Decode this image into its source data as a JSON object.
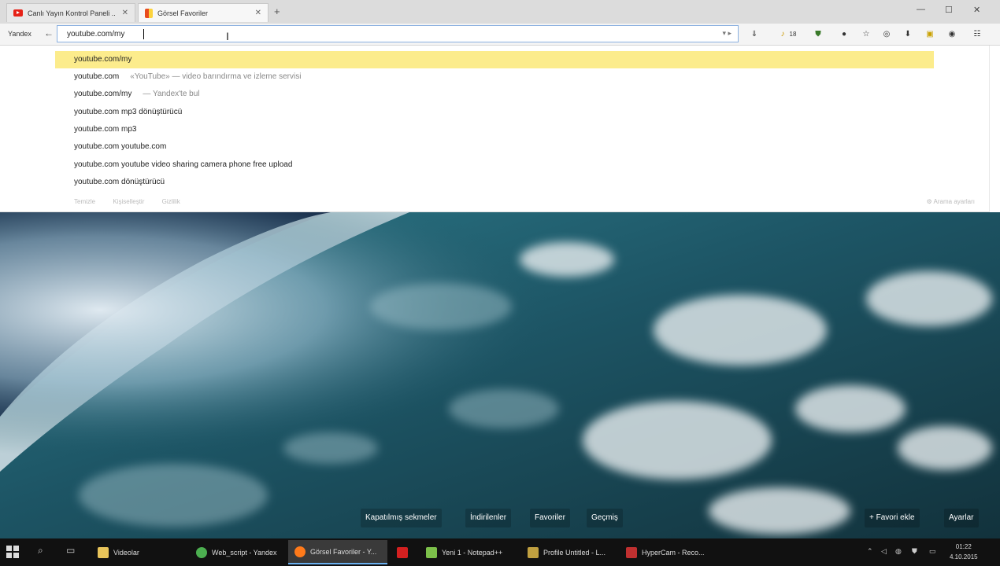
{
  "tabs": [
    {
      "label": "Canlı Yayın Kontrol Paneli ..",
      "icon": "youtube-icon",
      "active": false
    },
    {
      "label": "Görsel Favoriler",
      "icon": "yandex-icon",
      "active": true
    }
  ],
  "toolbar": {
    "menu_label": "Yandex",
    "url_value": "youtube.com/my",
    "extension_badge": "18"
  },
  "suggestions": [
    {
      "text": "youtube.com/my",
      "desc": "",
      "selected": true
    },
    {
      "text": "youtube.com",
      "desc": "«YouTube» — video barındırma ve izleme servisi",
      "selected": false
    },
    {
      "text": "youtube.com/my",
      "desc": "— Yandex'te bul",
      "selected": false
    },
    {
      "text": "youtube.com mp3 dönüştürücü",
      "desc": "",
      "selected": false
    },
    {
      "text": "youtube.com mp3",
      "desc": "",
      "selected": false
    },
    {
      "text": "youtube.com youtube.com",
      "desc": "",
      "selected": false
    },
    {
      "text": "youtube.com youtube video sharing camera phone free upload",
      "desc": "",
      "selected": false
    },
    {
      "text": "youtube.com dönüştürücü",
      "desc": "",
      "selected": false
    }
  ],
  "dropdown_footer": [
    "Temizle",
    "Kişiselleştir",
    "Gizlilik"
  ],
  "dropdown_settings": "Arama ayarları",
  "bottom_buttons": {
    "closed_tabs": "Kapatılmış sekmeler",
    "downloads": "İndirilenler",
    "favorites": "Favoriler",
    "history": "Geçmiş",
    "add_favorite": "+ Favori ekle",
    "settings": "Ayarlar"
  },
  "taskbar": {
    "items": [
      {
        "label": "Videolar",
        "icon": "folder-icon",
        "color": "#e8c45a",
        "active": false
      },
      {
        "label": "Web_script - Yandex",
        "icon": "chrome-icon",
        "color": "#4caf50",
        "active": false
      },
      {
        "label": "Görsel Favoriler - Y...",
        "icon": "firefox-icon",
        "color": "#ff7a1a",
        "active": true
      },
      {
        "label": "",
        "icon": "flashget-icon",
        "color": "#d42020",
        "active": false
      },
      {
        "label": "Yeni 1 - Notepad++",
        "icon": "notepad-icon",
        "color": "#7cc04a",
        "active": false
      },
      {
        "label": "Profile Untitled - L...",
        "icon": "tool-icon",
        "color": "#c0a040",
        "active": false
      },
      {
        "label": "HyperCam - Reco...",
        "icon": "hypercam-icon",
        "color": "#c03030",
        "active": false
      }
    ],
    "clock_time": "01:22",
    "clock_date": "4.10.2015"
  }
}
